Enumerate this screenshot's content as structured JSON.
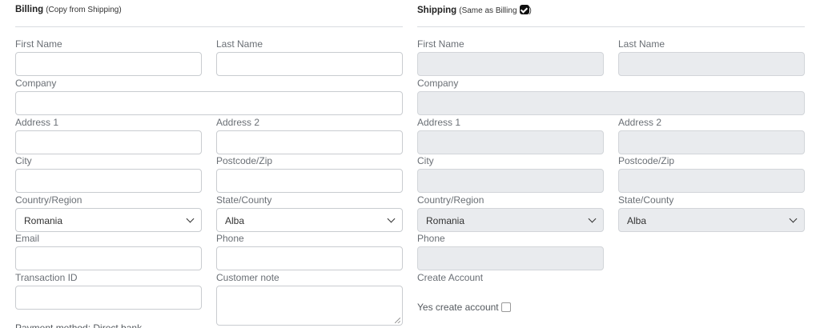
{
  "billing": {
    "title": "Billing",
    "subtitle": "(Copy from Shipping)",
    "first_name_label": "First Name",
    "last_name_label": "Last Name",
    "company_label": "Company",
    "address1_label": "Address 1",
    "address2_label": "Address 2",
    "city_label": "City",
    "postcode_label": "Postcode/Zip",
    "country_label": "Country/Region",
    "country_value": "Romania",
    "state_label": "State/County",
    "state_value": "Alba",
    "email_label": "Email",
    "phone_label": "Phone",
    "transaction_label": "Transaction ID",
    "note_label": "Customer note",
    "cut_text": "Payment method: Direct bank"
  },
  "shipping": {
    "title": "Shipping",
    "subtitle_pre": "(Same as Billing",
    "subtitle_post": ")",
    "same_as_billing_checked": true,
    "first_name_label": "First Name",
    "last_name_label": "Last Name",
    "company_label": "Company",
    "address1_label": "Address 1",
    "address2_label": "Address 2",
    "city_label": "City",
    "postcode_label": "Postcode/Zip",
    "country_label": "Country/Region",
    "country_value": "Romania",
    "state_label": "State/County",
    "state_value": "Alba",
    "phone_label": "Phone",
    "create_account_label": "Create Account",
    "yes_create_label": "Yes create account",
    "yes_create_checked": false
  },
  "icons": {
    "dropdown": "chevron-down-icon",
    "checkbox_checked": "checkbox-checked-icon",
    "resize": "resize-handle-icon"
  },
  "colors": {
    "disabled_bg": "#e9ebee",
    "border": "#c9ccd0",
    "label": "#6a6f75"
  }
}
